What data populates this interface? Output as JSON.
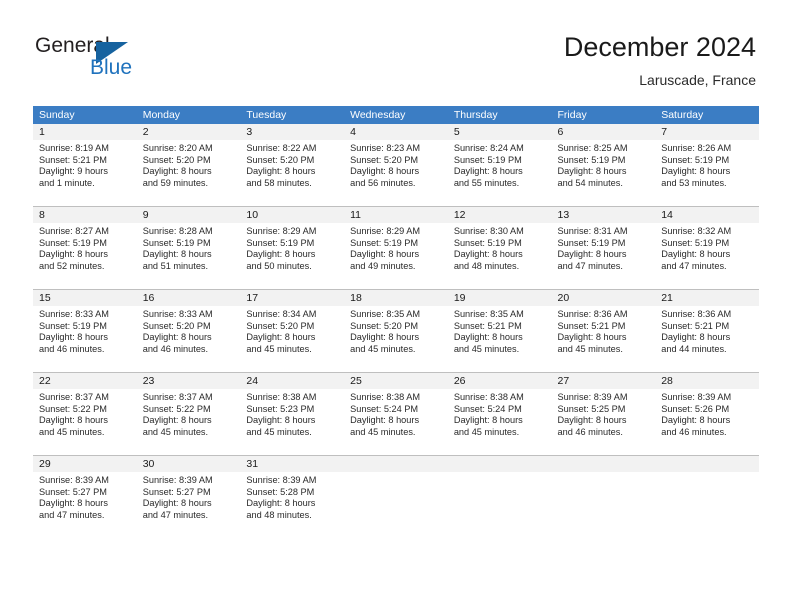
{
  "brand": {
    "name_part1": "General",
    "name_part2": "Blue",
    "flag_icon": "flag-icon"
  },
  "header": {
    "title": "December 2024",
    "subtitle": "Laruscade, France"
  },
  "colors": {
    "header_blue": "#3b7dc4",
    "daynum_background": "#f2f2f2",
    "brand_blue": "#1f72bd",
    "row_divider": "#bfbfbf"
  },
  "calendar": {
    "weekday_headers": [
      "Sunday",
      "Monday",
      "Tuesday",
      "Wednesday",
      "Thursday",
      "Friday",
      "Saturday"
    ],
    "weeks": [
      [
        {
          "day": "1",
          "sunrise": "Sunrise: 8:19 AM",
          "sunset": "Sunset: 5:21 PM",
          "daylight_line1": "Daylight: 9 hours",
          "daylight_line2": "and 1 minute."
        },
        {
          "day": "2",
          "sunrise": "Sunrise: 8:20 AM",
          "sunset": "Sunset: 5:20 PM",
          "daylight_line1": "Daylight: 8 hours",
          "daylight_line2": "and 59 minutes."
        },
        {
          "day": "3",
          "sunrise": "Sunrise: 8:22 AM",
          "sunset": "Sunset: 5:20 PM",
          "daylight_line1": "Daylight: 8 hours",
          "daylight_line2": "and 58 minutes."
        },
        {
          "day": "4",
          "sunrise": "Sunrise: 8:23 AM",
          "sunset": "Sunset: 5:20 PM",
          "daylight_line1": "Daylight: 8 hours",
          "daylight_line2": "and 56 minutes."
        },
        {
          "day": "5",
          "sunrise": "Sunrise: 8:24 AM",
          "sunset": "Sunset: 5:19 PM",
          "daylight_line1": "Daylight: 8 hours",
          "daylight_line2": "and 55 minutes."
        },
        {
          "day": "6",
          "sunrise": "Sunrise: 8:25 AM",
          "sunset": "Sunset: 5:19 PM",
          "daylight_line1": "Daylight: 8 hours",
          "daylight_line2": "and 54 minutes."
        },
        {
          "day": "7",
          "sunrise": "Sunrise: 8:26 AM",
          "sunset": "Sunset: 5:19 PM",
          "daylight_line1": "Daylight: 8 hours",
          "daylight_line2": "and 53 minutes."
        }
      ],
      [
        {
          "day": "8",
          "sunrise": "Sunrise: 8:27 AM",
          "sunset": "Sunset: 5:19 PM",
          "daylight_line1": "Daylight: 8 hours",
          "daylight_line2": "and 52 minutes."
        },
        {
          "day": "9",
          "sunrise": "Sunrise: 8:28 AM",
          "sunset": "Sunset: 5:19 PM",
          "daylight_line1": "Daylight: 8 hours",
          "daylight_line2": "and 51 minutes."
        },
        {
          "day": "10",
          "sunrise": "Sunrise: 8:29 AM",
          "sunset": "Sunset: 5:19 PM",
          "daylight_line1": "Daylight: 8 hours",
          "daylight_line2": "and 50 minutes."
        },
        {
          "day": "11",
          "sunrise": "Sunrise: 8:29 AM",
          "sunset": "Sunset: 5:19 PM",
          "daylight_line1": "Daylight: 8 hours",
          "daylight_line2": "and 49 minutes."
        },
        {
          "day": "12",
          "sunrise": "Sunrise: 8:30 AM",
          "sunset": "Sunset: 5:19 PM",
          "daylight_line1": "Daylight: 8 hours",
          "daylight_line2": "and 48 minutes."
        },
        {
          "day": "13",
          "sunrise": "Sunrise: 8:31 AM",
          "sunset": "Sunset: 5:19 PM",
          "daylight_line1": "Daylight: 8 hours",
          "daylight_line2": "and 47 minutes."
        },
        {
          "day": "14",
          "sunrise": "Sunrise: 8:32 AM",
          "sunset": "Sunset: 5:19 PM",
          "daylight_line1": "Daylight: 8 hours",
          "daylight_line2": "and 47 minutes."
        }
      ],
      [
        {
          "day": "15",
          "sunrise": "Sunrise: 8:33 AM",
          "sunset": "Sunset: 5:19 PM",
          "daylight_line1": "Daylight: 8 hours",
          "daylight_line2": "and 46 minutes."
        },
        {
          "day": "16",
          "sunrise": "Sunrise: 8:33 AM",
          "sunset": "Sunset: 5:20 PM",
          "daylight_line1": "Daylight: 8 hours",
          "daylight_line2": "and 46 minutes."
        },
        {
          "day": "17",
          "sunrise": "Sunrise: 8:34 AM",
          "sunset": "Sunset: 5:20 PM",
          "daylight_line1": "Daylight: 8 hours",
          "daylight_line2": "and 45 minutes."
        },
        {
          "day": "18",
          "sunrise": "Sunrise: 8:35 AM",
          "sunset": "Sunset: 5:20 PM",
          "daylight_line1": "Daylight: 8 hours",
          "daylight_line2": "and 45 minutes."
        },
        {
          "day": "19",
          "sunrise": "Sunrise: 8:35 AM",
          "sunset": "Sunset: 5:21 PM",
          "daylight_line1": "Daylight: 8 hours",
          "daylight_line2": "and 45 minutes."
        },
        {
          "day": "20",
          "sunrise": "Sunrise: 8:36 AM",
          "sunset": "Sunset: 5:21 PM",
          "daylight_line1": "Daylight: 8 hours",
          "daylight_line2": "and 45 minutes."
        },
        {
          "day": "21",
          "sunrise": "Sunrise: 8:36 AM",
          "sunset": "Sunset: 5:21 PM",
          "daylight_line1": "Daylight: 8 hours",
          "daylight_line2": "and 44 minutes."
        }
      ],
      [
        {
          "day": "22",
          "sunrise": "Sunrise: 8:37 AM",
          "sunset": "Sunset: 5:22 PM",
          "daylight_line1": "Daylight: 8 hours",
          "daylight_line2": "and 45 minutes."
        },
        {
          "day": "23",
          "sunrise": "Sunrise: 8:37 AM",
          "sunset": "Sunset: 5:22 PM",
          "daylight_line1": "Daylight: 8 hours",
          "daylight_line2": "and 45 minutes."
        },
        {
          "day": "24",
          "sunrise": "Sunrise: 8:38 AM",
          "sunset": "Sunset: 5:23 PM",
          "daylight_line1": "Daylight: 8 hours",
          "daylight_line2": "and 45 minutes."
        },
        {
          "day": "25",
          "sunrise": "Sunrise: 8:38 AM",
          "sunset": "Sunset: 5:24 PM",
          "daylight_line1": "Daylight: 8 hours",
          "daylight_line2": "and 45 minutes."
        },
        {
          "day": "26",
          "sunrise": "Sunrise: 8:38 AM",
          "sunset": "Sunset: 5:24 PM",
          "daylight_line1": "Daylight: 8 hours",
          "daylight_line2": "and 45 minutes."
        },
        {
          "day": "27",
          "sunrise": "Sunrise: 8:39 AM",
          "sunset": "Sunset: 5:25 PM",
          "daylight_line1": "Daylight: 8 hours",
          "daylight_line2": "and 46 minutes."
        },
        {
          "day": "28",
          "sunrise": "Sunrise: 8:39 AM",
          "sunset": "Sunset: 5:26 PM",
          "daylight_line1": "Daylight: 8 hours",
          "daylight_line2": "and 46 minutes."
        }
      ],
      [
        {
          "day": "29",
          "sunrise": "Sunrise: 8:39 AM",
          "sunset": "Sunset: 5:27 PM",
          "daylight_line1": "Daylight: 8 hours",
          "daylight_line2": "and 47 minutes."
        },
        {
          "day": "30",
          "sunrise": "Sunrise: 8:39 AM",
          "sunset": "Sunset: 5:27 PM",
          "daylight_line1": "Daylight: 8 hours",
          "daylight_line2": "and 47 minutes."
        },
        {
          "day": "31",
          "sunrise": "Sunrise: 8:39 AM",
          "sunset": "Sunset: 5:28 PM",
          "daylight_line1": "Daylight: 8 hours",
          "daylight_line2": "and 48 minutes."
        },
        {
          "day": "",
          "sunrise": "",
          "sunset": "",
          "daylight_line1": "",
          "daylight_line2": ""
        },
        {
          "day": "",
          "sunrise": "",
          "sunset": "",
          "daylight_line1": "",
          "daylight_line2": ""
        },
        {
          "day": "",
          "sunrise": "",
          "sunset": "",
          "daylight_line1": "",
          "daylight_line2": ""
        },
        {
          "day": "",
          "sunrise": "",
          "sunset": "",
          "daylight_line1": "",
          "daylight_line2": ""
        }
      ]
    ]
  }
}
